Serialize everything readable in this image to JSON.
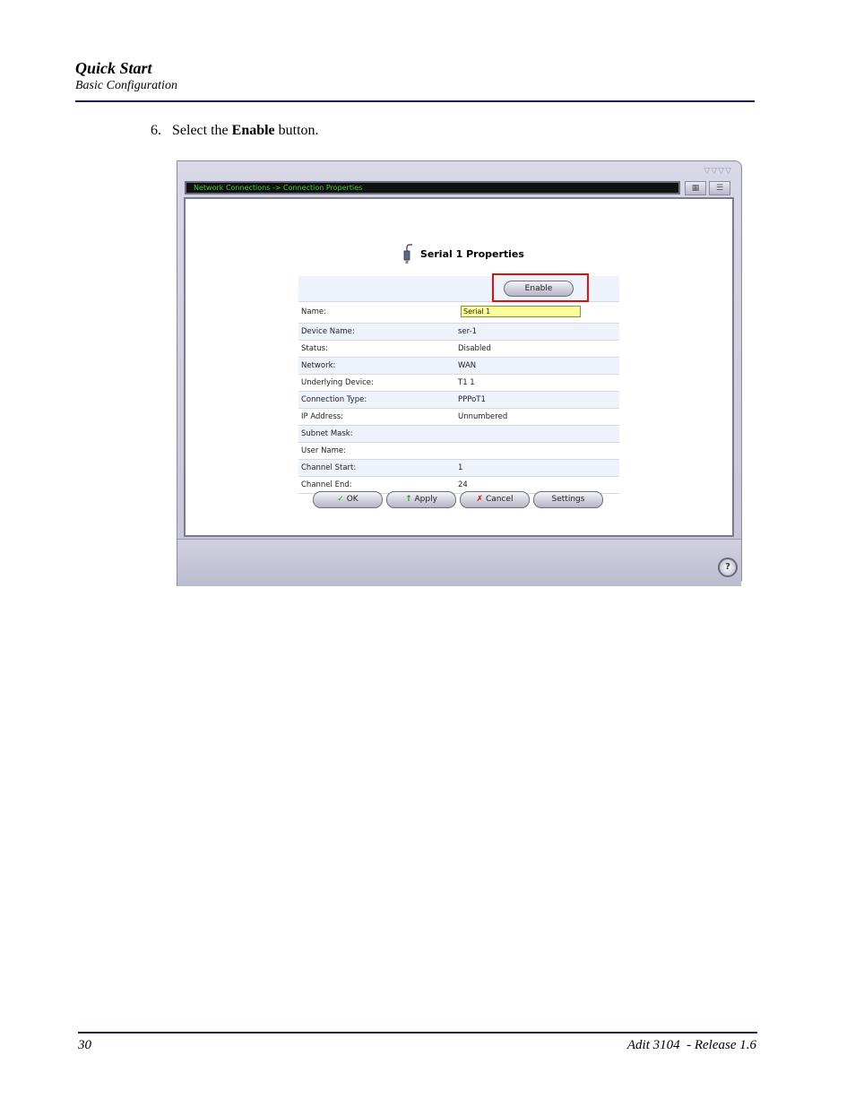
{
  "header": {
    "title": "Quick Start",
    "subtitle": "Basic Configuration"
  },
  "step": {
    "number": "6.",
    "before": "Select the",
    "bold": "Enable",
    "after": "button."
  },
  "window": {
    "breadcrumb": "Network Connections -> Connection Properties",
    "toolbar_icons": [
      "network-map-icon",
      "list-icon"
    ],
    "page_title": "Serial 1 Properties",
    "enable_label": "Enable",
    "fields": [
      {
        "key": "Name:",
        "value": "Serial 1"
      },
      {
        "key": "Device Name:",
        "value": "ser-1"
      },
      {
        "key": "Status:",
        "value": "Disabled"
      },
      {
        "key": "Network:",
        "value": "WAN"
      },
      {
        "key": "Underlying Device:",
        "value": "T1 1"
      },
      {
        "key": "Connection Type:",
        "value": "PPPoT1"
      },
      {
        "key": "IP Address:",
        "value": "Unnumbered"
      },
      {
        "key": "Subnet Mask:",
        "value": ""
      },
      {
        "key": "User Name:",
        "value": ""
      },
      {
        "key": "Channel Start:",
        "value": "1"
      },
      {
        "key": "Channel End:",
        "value": "24"
      }
    ],
    "buttons": {
      "ok": "OK",
      "apply": "Apply",
      "cancel": "Cancel",
      "settings": "Settings"
    },
    "help_label": "?",
    "highlight_color": "#e01010"
  },
  "footer": {
    "page": "30",
    "release": "Adit 3104  - Release 1.6"
  }
}
